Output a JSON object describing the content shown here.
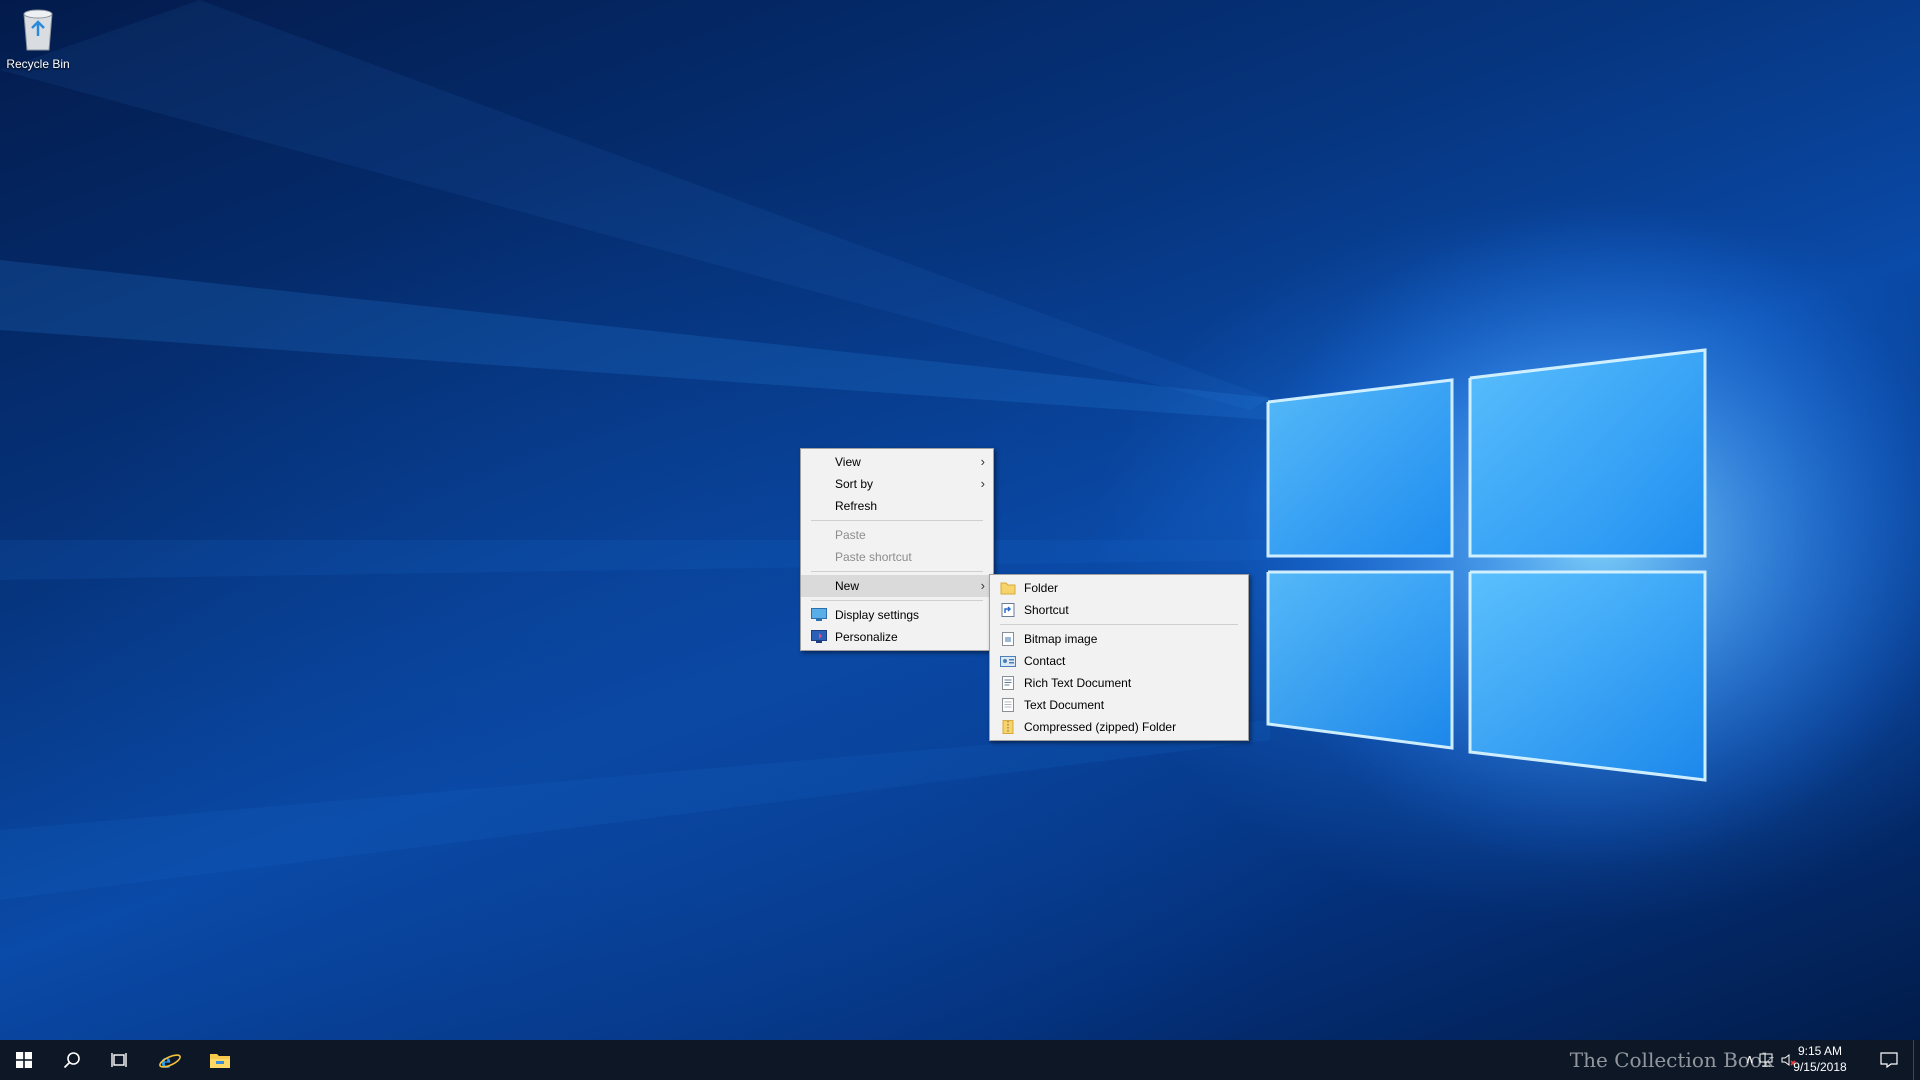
{
  "desktop": {
    "recycle_bin_label": "Recycle Bin"
  },
  "context_menu": {
    "items": [
      {
        "label": "View"
      },
      {
        "label": "Sort by"
      },
      {
        "label": "Refresh"
      },
      {
        "label": "Paste"
      },
      {
        "label": "Paste shortcut"
      },
      {
        "label": "New"
      },
      {
        "label": "Display settings"
      },
      {
        "label": "Personalize"
      }
    ]
  },
  "new_submenu": {
    "items": [
      {
        "label": "Folder"
      },
      {
        "label": "Shortcut"
      },
      {
        "label": "Bitmap image"
      },
      {
        "label": "Contact"
      },
      {
        "label": "Rich Text Document"
      },
      {
        "label": "Text Document"
      },
      {
        "label": "Compressed (zipped) Folder"
      }
    ]
  },
  "taskbar": {
    "time": "9:15 AM",
    "date": "9/15/2018",
    "watermark": "The Collection Book"
  },
  "colors": {
    "taskbar": "#0d1726",
    "menu_bg": "#f2f2f2",
    "menu_hover": "#dadada"
  }
}
